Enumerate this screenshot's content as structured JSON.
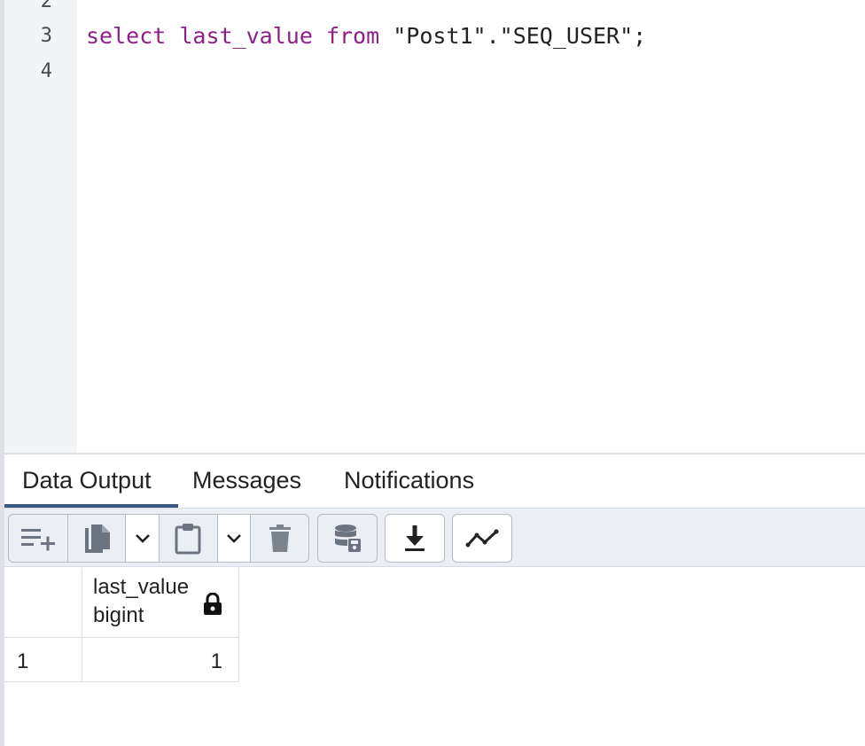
{
  "editor": {
    "lines": [
      {
        "number": "2",
        "code": ""
      },
      {
        "number": "3",
        "code": "select last_value from \"Post1\".\"SEQ_USER\";"
      },
      {
        "number": "4",
        "code": ""
      }
    ],
    "query": {
      "kw_select": "select",
      "ident": "last_value",
      "kw_from": "from",
      "target": "\"Post1\".\"SEQ_USER\";"
    }
  },
  "tabs": [
    {
      "label": "Data Output",
      "active": true
    },
    {
      "label": "Messages",
      "active": false
    },
    {
      "label": "Notifications",
      "active": false
    }
  ],
  "toolbar": {
    "buttons": [
      "add-row-icon",
      "copy-icon",
      "copy-dropdown-icon",
      "paste-icon",
      "paste-dropdown-icon",
      "delete-icon",
      "save-data-icon",
      "download-icon",
      "graph-icon"
    ]
  },
  "grid": {
    "columns": [
      {
        "name": "last_value",
        "type": "bigint",
        "locked": true
      }
    ],
    "rows": [
      {
        "row_number": "1",
        "values": [
          "1"
        ]
      }
    ]
  },
  "colors": {
    "keyword": "#8e1f8a",
    "active_tab_underline": "#3a5a80",
    "toolbar_bg": "#ebeef2"
  }
}
